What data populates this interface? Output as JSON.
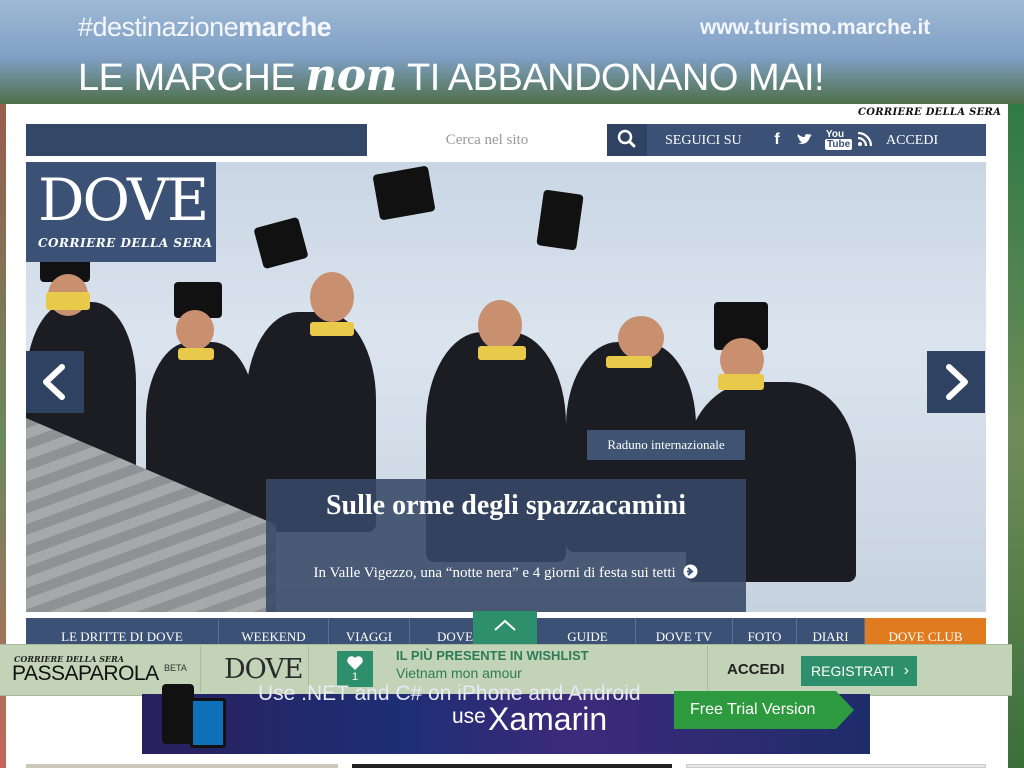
{
  "banner": {
    "hash_prefix": "#destinazione",
    "hash_bold": "marche",
    "url": "www.turismo.marche.it",
    "line_before": "LE MARCHE",
    "line_em": "non",
    "line_after": "TI ABBANDONANO MAI!"
  },
  "header": {
    "corriere": "CORRIERE DELLA SERA",
    "search_placeholder": "Cerca nel sito",
    "seguici": "SEGUICI SU",
    "social": [
      "facebook-icon",
      "twitter-icon",
      "youtube-icon",
      "rss-icon"
    ],
    "accedi": "ACCEDI"
  },
  "logo": {
    "dove": "DOVE",
    "corriere": "CORRIERE DELLA SERA"
  },
  "hero": {
    "tag": "Raduno internazionale",
    "title": "Sulle orme degli spazzacamini",
    "subtitle": "In Valle Vigezzo, una “notte nera” e 4 giorni di festa sui tetti"
  },
  "menu": {
    "items": [
      "LE DRITTE DI DOVE",
      "WEEKEND",
      "VIAGGI",
      "DOVE",
      "GUIDE",
      "DOVE TV",
      "FOTO",
      "DIARI",
      "DOVE CLUB"
    ]
  },
  "passaparola": {
    "corriere": "CORRIERE DELLA SERA",
    "title": "PASSAPAROLA",
    "beta": "BETA",
    "dove": "DOVE",
    "wishlist_count": "1",
    "label": "IL PIÙ PRESENTE IN WISHLIST",
    "item": "Vietnam mon amour",
    "accedi": "ACCEDI",
    "registrati": "REGISTRATI"
  },
  "ad": {
    "text1": "Use .NET and C# on iPhone and Android",
    "text2": "use",
    "brand": "Xamarin",
    "cta": "Free Trial Version"
  },
  "colors": {
    "navy": "#3b5276",
    "green": "#2e8f6c",
    "orange": "#e07b1f"
  }
}
